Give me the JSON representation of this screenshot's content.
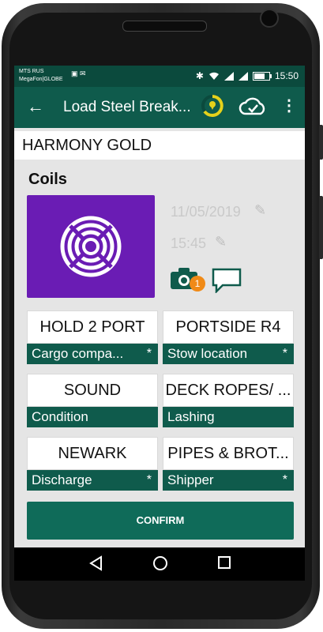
{
  "statusbar": {
    "operator_1": "MTS RUS",
    "operator_2": "MegaFon|GLOBE",
    "time": "15:50",
    "battery_level_pct": 70
  },
  "appbar": {
    "title": "Load Steel Break...",
    "back_icon": "arrow-left-icon",
    "timer_icon": "timer-icon",
    "cloud_icon": "cloud-check-icon",
    "menu_icon": "more-vert-icon"
  },
  "vessel": {
    "name": "HARMONY GOLD"
  },
  "cargo": {
    "type": "Coils",
    "image_color": "#6a1cb4",
    "date": "11/05/2019",
    "time": "15:45",
    "photo_count": "1"
  },
  "fields": [
    {
      "value": "HOLD 2 PORT",
      "label": "Cargo compa...",
      "required": "*"
    },
    {
      "value": "PORTSIDE R4",
      "label": "Stow location",
      "required": "*"
    },
    {
      "value": "SOUND",
      "label": "Condition",
      "required": ""
    },
    {
      "value": "DECK ROPES/ ...",
      "label": "Lashing",
      "required": ""
    },
    {
      "value": "NEWARK",
      "label": "Discharge",
      "required": "*"
    },
    {
      "value": "PIPES & BROT...",
      "label": "Shipper",
      "required": "*"
    }
  ],
  "actions": {
    "confirm_label": "CONFIRM"
  },
  "colors": {
    "accent": "#0f5b4c",
    "statusbar": "#0b4a3d",
    "badge": "#f08a17",
    "timer_ring": "#e6d21b"
  }
}
